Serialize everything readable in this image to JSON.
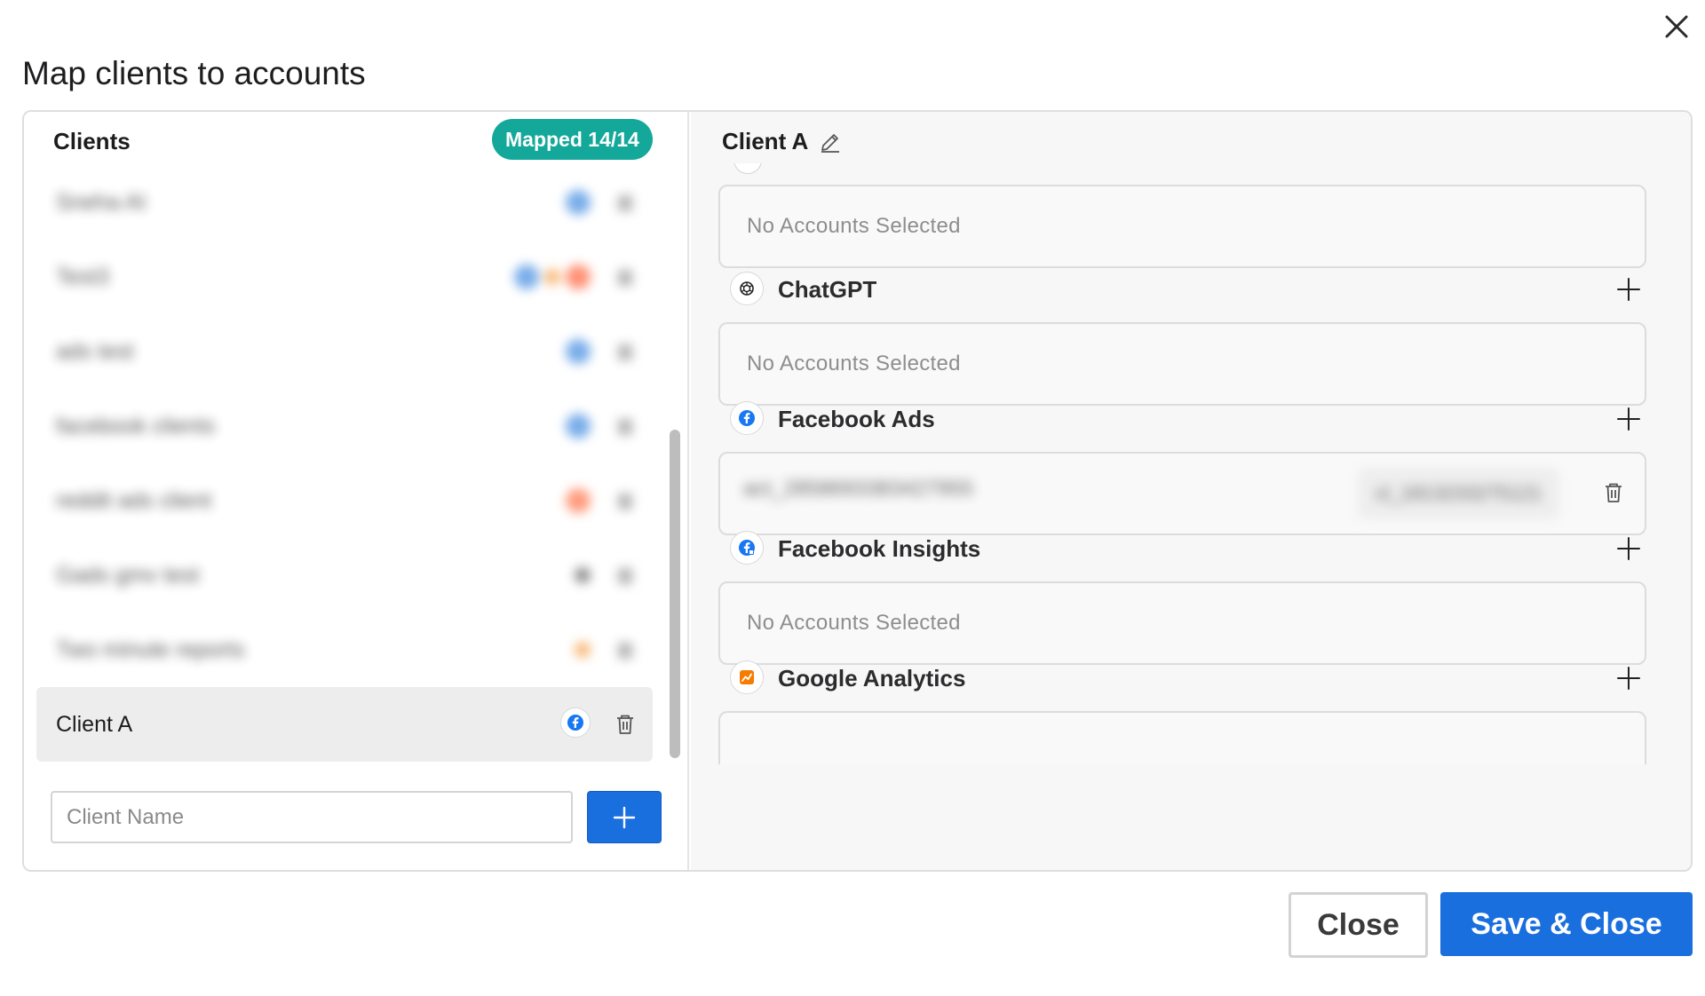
{
  "dialog": {
    "title": "Map clients to accounts",
    "close_icon": "close-icon"
  },
  "clients_panel": {
    "title": "Clients",
    "mapped_badge": "Mapped 14/14",
    "badge_color": "#14a89a",
    "clients": [
      {
        "name": "Sneha AI",
        "blurred": true
      },
      {
        "name": "Test3",
        "blurred": true
      },
      {
        "name": "ads test",
        "blurred": true
      },
      {
        "name": "facebook clients",
        "blurred": true
      },
      {
        "name": "reddit ads client",
        "blurred": true
      },
      {
        "name": "Gads gmv test",
        "blurred": true
      },
      {
        "name": "Two minute reports",
        "blurred": true
      },
      {
        "name": "Client A",
        "blurred": false,
        "selected": true
      }
    ],
    "client_name_placeholder": "Client Name",
    "add_icon": "plus-icon"
  },
  "detail_panel": {
    "client_title": "Client A",
    "edit_icon": "pencil-icon",
    "empty_text": "No Accounts Selected",
    "platforms": [
      {
        "name": "ChatGPT",
        "icon": "openai-icon"
      },
      {
        "name": "Facebook Ads",
        "icon": "facebook-icon",
        "account_id": "act_2858693383427955",
        "account_label": "cl_1813233275121"
      },
      {
        "name": "Facebook Insights",
        "icon": "facebook-insights-icon"
      },
      {
        "name": "Google Analytics",
        "icon": "google-analytics-icon"
      }
    ]
  },
  "footer": {
    "close_label": "Close",
    "save_label": "Save & Close",
    "accent_color": "#1a6fdf"
  }
}
